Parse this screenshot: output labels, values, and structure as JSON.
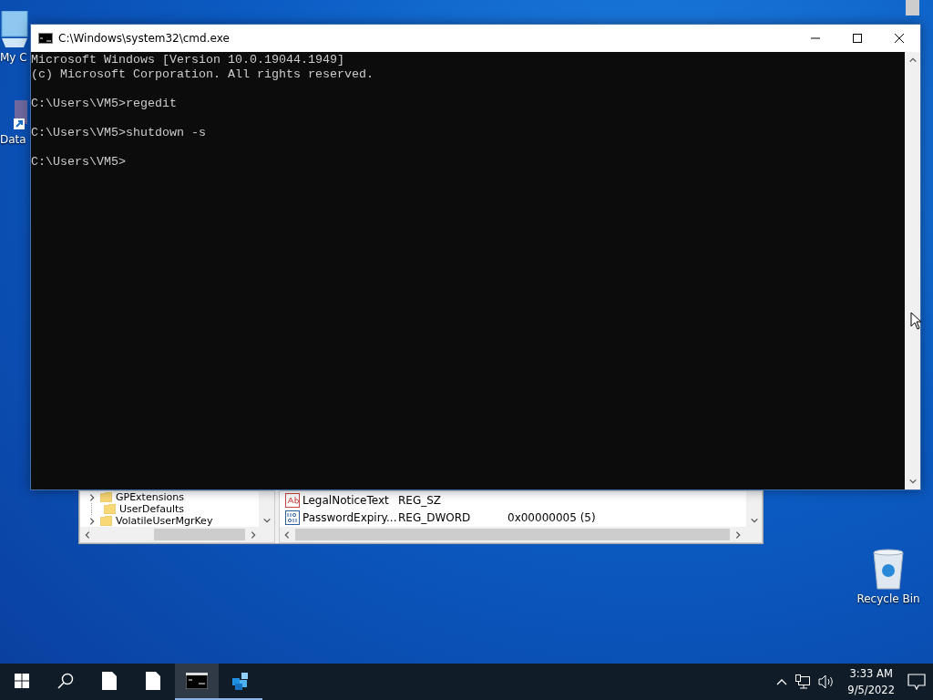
{
  "desktop_icons": [
    {
      "kind": "computer",
      "label": "My C"
    },
    {
      "kind": "shortcut",
      "label": "Data"
    },
    {
      "kind": "recycle-bin",
      "label": "Recycle Bin"
    }
  ],
  "registry_editor": {
    "tree_items": [
      {
        "label": "GPExtensions",
        "expandable": true
      },
      {
        "label": "UserDefaults",
        "expandable": false
      },
      {
        "label": "VolatileUserMgrKey",
        "expandable": true
      }
    ],
    "values": [
      {
        "kind": "string",
        "name": "LegalNoticeText",
        "type": "REG_SZ"
      },
      {
        "kind": "number",
        "name": "PasswordExpiry...",
        "type": "REG_DWORD",
        "data": "0x00000005 (5)"
      }
    ]
  },
  "console_window": {
    "title": "C:\\Windows\\system32\\cmd.exe",
    "blocks": [
      [
        "Microsoft Windows [Version 10.0.19044.1949]",
        "(c) Microsoft Corporation. All rights reserved."
      ],
      [
        "C:\\Users\\VM5>regedit"
      ],
      [
        "C:\\Users\\VM5>shutdown -s"
      ],
      [
        "C:\\Users\\VM5>"
      ]
    ]
  },
  "taskbar": {
    "items": [
      {
        "kind": "file",
        "selected": false,
        "running": false
      },
      {
        "kind": "file",
        "selected": false,
        "running": false
      },
      {
        "kind": "terminal",
        "selected": true,
        "running": true
      },
      {
        "kind": "registry",
        "selected": false,
        "running": true
      }
    ],
    "time": "3:33 AM",
    "date": "9/5/2022"
  }
}
